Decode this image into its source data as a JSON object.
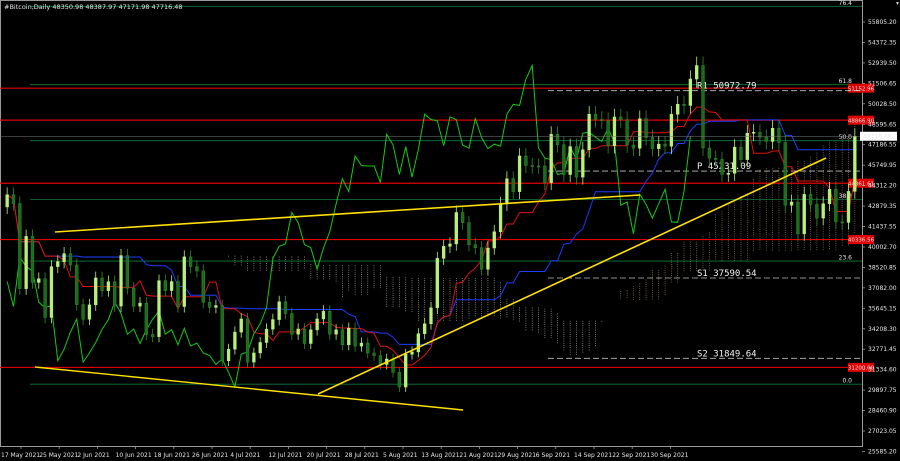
{
  "header": {
    "symbol_line": "#Bitcoin,Daily  48350.98 48387.97 47171.98 47716.48"
  },
  "colors": {
    "background": "#000000",
    "bull": "#b8f07a",
    "bear": "#1b6b1b",
    "tenkan": "#e01010",
    "kijun": "#1f3cff",
    "chikou": "#15c915",
    "trend": "#ffe000",
    "level": "#e00000",
    "fib": "#0f7a3c",
    "cloud": "#d8d8d8"
  },
  "price_axis": {
    "ticks": [
      "55805.20",
      "54372.35",
      "52939.50",
      "51506.65",
      "50028.50",
      "48595.65",
      "47186.55",
      "45749.95",
      "44312.20",
      "42879.35",
      "41437.55",
      "40002.70",
      "38520.85",
      "37082.00",
      "35645.15",
      "34208.30",
      "32771.45",
      "31334.60",
      "29897.75",
      "28460.90",
      "27023.05",
      "25585.20"
    ],
    "current_price": "47716.48",
    "level_labels": [
      "51152.96",
      "48866.90",
      "44361.61",
      "40336.56",
      "31200.00"
    ]
  },
  "date_axis": {
    "ticks": [
      "17 May 2021",
      "25 May 2021",
      "2 Jun 2021",
      "10 Jun 2021",
      "18 Jun 2021",
      "26 Jun 2021",
      "4 Jul 2021",
      "12 Jul 2021",
      "20 Jul 2021",
      "28 Jul 2021",
      "5 Aug 2021",
      "13 Aug 2021",
      "21 Aug 2021",
      "29 Aug 2021",
      "6 Sep 2021",
      "14 Sep 2021",
      "22 Sep 2021",
      "30 Sep 2021"
    ]
  },
  "pivots": {
    "r1": "R1 50972.79",
    "p": "P 45231.09",
    "s1": "S1 37590.54",
    "s2": "S2 31849.64"
  },
  "fib_labels": [
    "76.4",
    "61.8",
    "50.0",
    "38.2",
    "23.6",
    "0.0"
  ],
  "chart_data": {
    "type": "candlestick",
    "title": "#Bitcoin,Daily",
    "ohlc_current": {
      "open": 48350.98,
      "high": 48387.97,
      "low": 47171.98,
      "close": 47716.48
    },
    "ylim": [
      25585.2,
      57238
    ],
    "xlim": [
      "2021-05-17",
      "2021-10-07"
    ],
    "closes": [
      43537,
      42909,
      36828,
      40566,
      37272,
      37536,
      34770,
      38402,
      38749,
      39328,
      38520,
      35689,
      34641,
      35670,
      37593,
      36685,
      37321,
      35582,
      39193,
      36858,
      35578,
      35794,
      33558,
      33399,
      37394,
      36690,
      37335,
      35550,
      39098,
      38405,
      38094,
      35850,
      35490,
      35619,
      31677,
      32505,
      33723,
      34663,
      31579,
      32233,
      32982,
      33937,
      34618,
      35891,
      35049,
      33571,
      33944,
      32911,
      33883,
      34663,
      35220,
      33578,
      33886,
      32816,
      33997,
      32722,
      32942,
      32229,
      32051,
      31414,
      31802,
      30847,
      29797,
      32138,
      32306,
      33609,
      34316,
      35457,
      38991,
      39851,
      40023,
      42270,
      41541,
      39968,
      39756,
      38215,
      39729,
      40895,
      42884,
      44679,
      43761,
      46308,
      45630,
      45592,
      45588,
      44403,
      47859,
      47108,
      44982,
      46980,
      44798,
      46753,
      49291,
      48917,
      48836,
      47045,
      49095,
      48909,
      47091,
      46863,
      48972,
      47629,
      46829,
      47155,
      47009,
      49288,
      50002,
      49920,
      51805,
      52770,
      46880,
      46150,
      46060,
      44994,
      45072,
      46941,
      46049,
      47932,
      48000,
      47651,
      47347,
      48287,
      47271,
      42790,
      43018,
      40747,
      43566,
      42850,
      41869,
      42898,
      43928,
      41595,
      41567,
      43777,
      47716
    ],
    "annotations": [
      "R1 50972.79",
      "P 45231.09",
      "S1 37590.54",
      "S2 31849.64"
    ]
  }
}
